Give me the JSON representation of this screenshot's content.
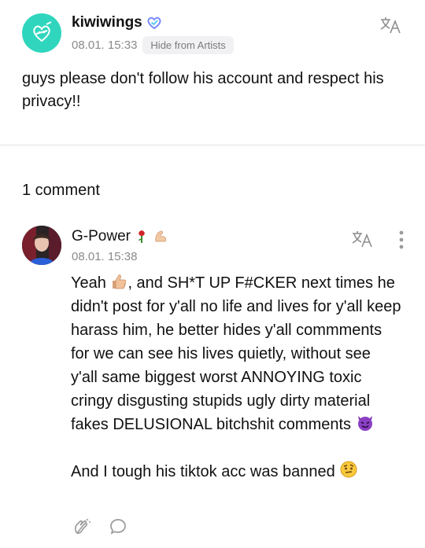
{
  "post": {
    "author": "kiwiwings",
    "timestamp": "08.01. 15:33",
    "hide_chip": "Hide from Artists",
    "text": "guys please don't follow his account and respect his privacy!!"
  },
  "comments_header": {
    "count_label": "1 comment"
  },
  "comment": {
    "author": "G-Power",
    "timestamp": "08.01. 15:38",
    "line1_a": "Yeah",
    "line1_b": ", and SH*T UP F#CKER next times he didn't post for y'all no life and lives for y'all keep harass him, he better hides y'all commments for we can see his lives quietly, without see y'all same biggest worst ANNOYING toxic cringy disgusting stupids ugly dirty material fakes DELUSIONAL bitchshit comments",
    "line2": "And I tough his tiktok acc was banned"
  },
  "colors": {
    "accent": "#2fd6bd",
    "verified": "#7b8cff"
  },
  "icons": [
    "translate-icon",
    "verified-heart-icon",
    "more-vertical-icon",
    "cheer-icon",
    "comment-bubble-icon"
  ]
}
